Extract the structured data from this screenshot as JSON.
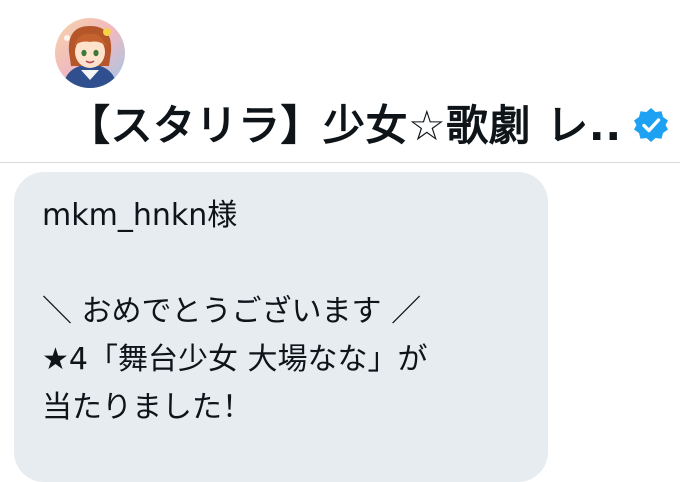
{
  "header": {
    "account_name": "【スタリラ】少女☆歌劇 レ...",
    "verified_icon": "verified-badge-icon",
    "colors": {
      "verified": "#1da1f2",
      "bubble": "#e6ecf0"
    }
  },
  "message": {
    "recipient_line": "mkm_hnkn様",
    "congrats_line": "＼ おめでとうございます ／",
    "prize_line": "★4「舞台少女 大場なな」が",
    "result_line": "当たりました！"
  }
}
